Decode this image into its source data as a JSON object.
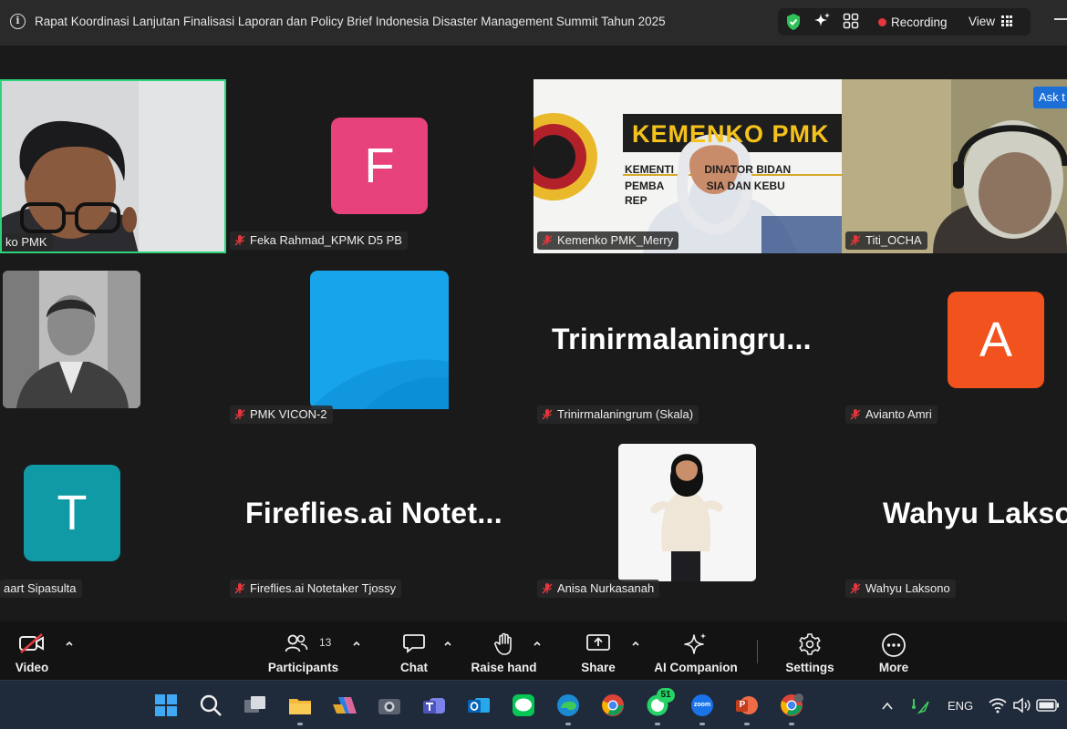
{
  "window": {
    "title": "Rapat Koordinasi Lanjutan Finalisasi Laporan dan Policy Brief Indonesia Disaster Management Summit Tahun 2025",
    "recording_label": "Recording",
    "view_label": "View"
  },
  "gallery": {
    "participants": [
      {
        "name": "ko PMK",
        "muted": false,
        "type": "video"
      },
      {
        "name": "Feka Rahmad_KPMK D5 PB",
        "muted": true,
        "type": "avatar",
        "initial": "F",
        "color": "#e8427c"
      },
      {
        "name": "Kemenko PMK_Merry",
        "muted": true,
        "type": "video",
        "banner": "KEMENKO PMK",
        "banner_line1": "KEMENTI          DINATOR BIDAN",
        "banner_line2": "PEMBA              SIA DAN KEBU",
        "banner_line3": "REP"
      },
      {
        "name": "Titi_OCHA",
        "muted": true,
        "type": "video"
      },
      {
        "name": "",
        "muted": false,
        "type": "photo"
      },
      {
        "name": "PMK VICON-2",
        "muted": true,
        "type": "tile"
      },
      {
        "name": "Trinirmalaningrum (Skala)",
        "muted": true,
        "type": "text",
        "display": "Trinirmalaningru..."
      },
      {
        "name": "Avianto Amri",
        "muted": true,
        "type": "avatar",
        "initial": "A",
        "color": "#f2521e"
      },
      {
        "name": "aart Sipasulta",
        "muted": false,
        "type": "avatar",
        "initial": "T",
        "color": "#0f9aa6"
      },
      {
        "name": "Fireflies.ai Notetaker Tjossy",
        "muted": true,
        "type": "text",
        "display": "Fireflies.ai  Notet..."
      },
      {
        "name": "Anisa Nurkasanah",
        "muted": true,
        "type": "photo"
      },
      {
        "name": "Wahyu Laksono",
        "muted": true,
        "type": "text",
        "display": "Wahyu Lakso"
      }
    ],
    "ask_label": "Ask t"
  },
  "toolbar": {
    "video": "Video",
    "participants": "Participants",
    "participants_count": "13",
    "chat": "Chat",
    "raise_hand": "Raise hand",
    "share": "Share",
    "ai_companion": "AI Companion",
    "settings": "Settings",
    "more": "More"
  },
  "taskbar": {
    "whatsapp_badge": "51",
    "zoom_label": "zoom",
    "language": "ENG"
  },
  "colors": {
    "active_speaker_border": "#2fd37c",
    "recording": "#e4373d",
    "toolbar_bg": "#131313",
    "gallery_bg": "#1a1a1a"
  }
}
